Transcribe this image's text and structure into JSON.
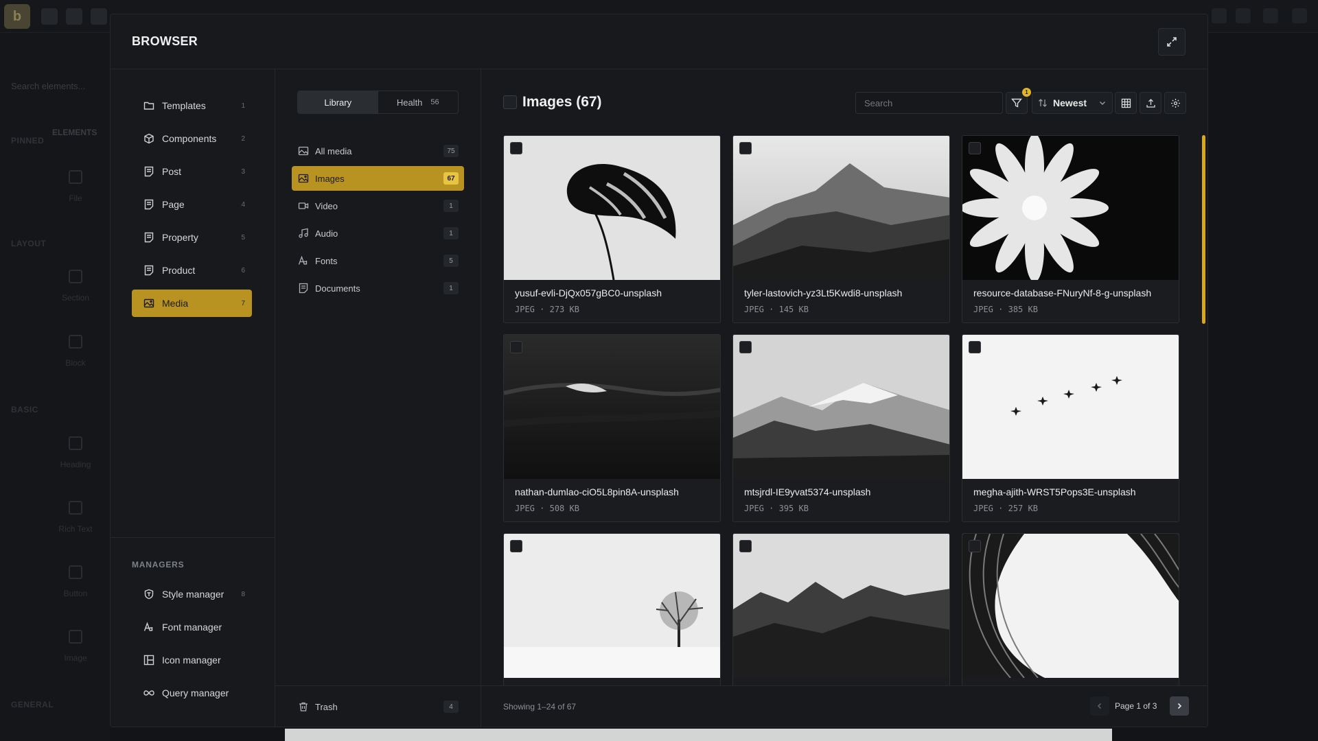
{
  "background": {
    "logo": "b",
    "search_placeholder": "Search elements...",
    "tab_elements": "ELEMENTS",
    "groups": [
      "PINNED",
      "LAYOUT",
      "BASIC",
      "GENERAL"
    ],
    "items": [
      "File",
      "Section",
      "Block",
      "Heading",
      "Rich Text",
      "Button",
      "Image"
    ]
  },
  "browser": {
    "title": "BROWSER",
    "expand_icon": "expand-icon"
  },
  "nav": {
    "items": [
      {
        "label": "Templates",
        "count": "1",
        "icon": "folder-icon"
      },
      {
        "label": "Components",
        "count": "2",
        "icon": "cube-icon"
      },
      {
        "label": "Post",
        "count": "3",
        "icon": "document-icon"
      },
      {
        "label": "Page",
        "count": "4",
        "icon": "document-icon"
      },
      {
        "label": "Property",
        "count": "5",
        "icon": "document-icon"
      },
      {
        "label": "Product",
        "count": "6",
        "icon": "document-icon"
      },
      {
        "label": "Media",
        "count": "7",
        "icon": "image-icon",
        "active": true
      }
    ],
    "managers_label": "MANAGERS",
    "managers": [
      {
        "label": "Style manager",
        "count": "8",
        "icon": "shield-icon"
      },
      {
        "label": "Font manager",
        "count": "",
        "icon": "font-icon"
      },
      {
        "label": "Icon manager",
        "count": "",
        "icon": "grid-icon"
      },
      {
        "label": "Query manager",
        "count": "",
        "icon": "infinity-icon"
      }
    ]
  },
  "library": {
    "tabs": [
      {
        "label": "Library",
        "count": "",
        "active": true
      },
      {
        "label": "Health",
        "count": "56",
        "active": false
      }
    ],
    "categories": [
      {
        "label": "All media",
        "count": "75",
        "icon": "media-icon"
      },
      {
        "label": "Images",
        "count": "67",
        "icon": "image-icon",
        "active": true
      },
      {
        "label": "Video",
        "count": "1",
        "icon": "video-icon"
      },
      {
        "label": "Audio",
        "count": "1",
        "icon": "music-icon"
      },
      {
        "label": "Fonts",
        "count": "5",
        "icon": "font-icon"
      },
      {
        "label": "Documents",
        "count": "1",
        "icon": "document-icon"
      }
    ],
    "trash": {
      "label": "Trash",
      "count": "4",
      "icon": "trash-icon"
    }
  },
  "gallery": {
    "title": "Images (67)",
    "search_placeholder": "Search",
    "filter_badge": "1",
    "sort_label": "Newest",
    "accent": "#d8a91f",
    "cards": [
      {
        "name": "yusuf-evli-DjQx057gBC0-unsplash",
        "type": "JPEG",
        "size": "273 KB",
        "thumb": "leaf"
      },
      {
        "name": "tyler-lastovich-yz3Lt5Kwdi8-unsplash",
        "type": "JPEG",
        "size": "145 KB",
        "thumb": "mountains"
      },
      {
        "name": "resource-database-FNuryNf-8-g-unsplash",
        "type": "JPEG",
        "size": "385 KB",
        "thumb": "flower"
      },
      {
        "name": "nathan-dumlao-ciO5L8pin8A-unsplash",
        "type": "JPEG",
        "size": "508 KB",
        "thumb": "wave"
      },
      {
        "name": "mtsjrdl-IE9yvat5374-unsplash",
        "type": "JPEG",
        "size": "395 KB",
        "thumb": "snowpeak"
      },
      {
        "name": "megha-ajith-WRST5Pops3E-unsplash",
        "type": "JPEG",
        "size": "257 KB",
        "thumb": "birds"
      },
      {
        "name": "",
        "type": "",
        "size": "",
        "thumb": "tree"
      },
      {
        "name": "",
        "type": "",
        "size": "",
        "thumb": "foggy"
      },
      {
        "name": "",
        "type": "",
        "size": "",
        "thumb": "architecture"
      }
    ],
    "showing": "Showing 1–24 of 67",
    "page_label": "Page 1 of 3"
  }
}
